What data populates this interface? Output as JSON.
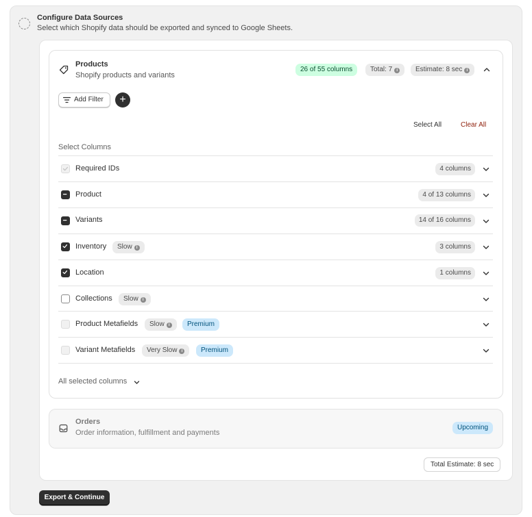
{
  "step": {
    "title": "Configure Data Sources",
    "subtitle": "Select which Shopify data should be exported and synced to Google Sheets."
  },
  "products": {
    "title": "Products",
    "subtitle": "Shopify products and variants",
    "icon": "tag-icon",
    "columns_badge": "26 of 55 columns",
    "total_badge": "Total: 7",
    "estimate_badge": "Estimate: 8 sec",
    "add_filter_label": "Add Filter",
    "add_button_label": "+",
    "select_all_label": "Select All",
    "clear_all_label": "Clear All",
    "select_columns_label": "Select Columns",
    "rows": [
      {
        "name": "Required IDs",
        "state": "disabled",
        "count": "4 columns",
        "badges": []
      },
      {
        "name": "Product",
        "state": "indeterminate",
        "count": "4 of 13 columns",
        "badges": []
      },
      {
        "name": "Variants",
        "state": "indeterminate",
        "count": "14 of 16 columns",
        "badges": []
      },
      {
        "name": "Inventory",
        "state": "checked",
        "count": "3 columns",
        "badges": [
          "Slow"
        ]
      },
      {
        "name": "Location",
        "state": "checked",
        "count": "1 columns",
        "badges": []
      },
      {
        "name": "Collections",
        "state": "unchecked",
        "count": "",
        "badges": [
          "Slow"
        ]
      },
      {
        "name": "Product Metafields",
        "state": "disabled",
        "count": "",
        "badges": [
          "Slow",
          "Premium"
        ]
      },
      {
        "name": "Variant Metafields",
        "state": "disabled",
        "count": "",
        "badges": [
          "Very Slow",
          "Premium"
        ]
      }
    ],
    "all_selected_label": "All selected columns"
  },
  "orders": {
    "title": "Orders",
    "subtitle": "Order information, fulfillment and payments",
    "icon": "inbox-icon",
    "status_badge": "Upcoming"
  },
  "total_estimate": "Total Estimate: 8 sec",
  "export_button": "Export & Continue",
  "colors": {
    "accent_dark": "#303030",
    "success_bg": "#cdfee1",
    "info_bg": "#cce8fb",
    "critical_text": "#8e1f0b"
  }
}
